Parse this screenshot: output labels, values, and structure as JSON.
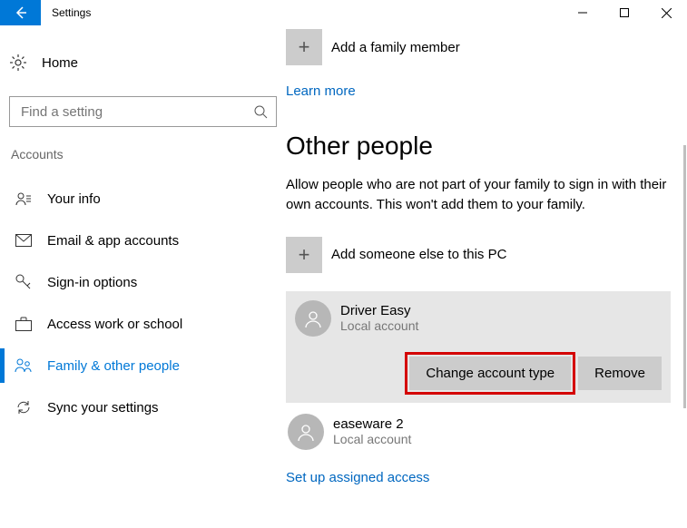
{
  "window": {
    "title": "Settings"
  },
  "left": {
    "home": "Home",
    "search_placeholder": "Find a setting",
    "section": "Accounts",
    "items": [
      {
        "label": "Your info"
      },
      {
        "label": "Email & app accounts"
      },
      {
        "label": "Sign-in options"
      },
      {
        "label": "Access work or school"
      },
      {
        "label": "Family & other people"
      },
      {
        "label": "Sync your settings"
      }
    ]
  },
  "main": {
    "add_family": "Add a family member",
    "learn_more": "Learn more",
    "other_heading": "Other people",
    "other_desc": "Allow people who are not part of your family to sign in with their own accounts. This won't add them to your family.",
    "add_other": "Add someone else to this PC",
    "user1": {
      "name": "Driver Easy",
      "sub": "Local account"
    },
    "change_btn": "Change account type",
    "remove_btn": "Remove",
    "user2": {
      "name": "easeware 2",
      "sub": "Local account"
    },
    "assigned": "Set up assigned access"
  }
}
